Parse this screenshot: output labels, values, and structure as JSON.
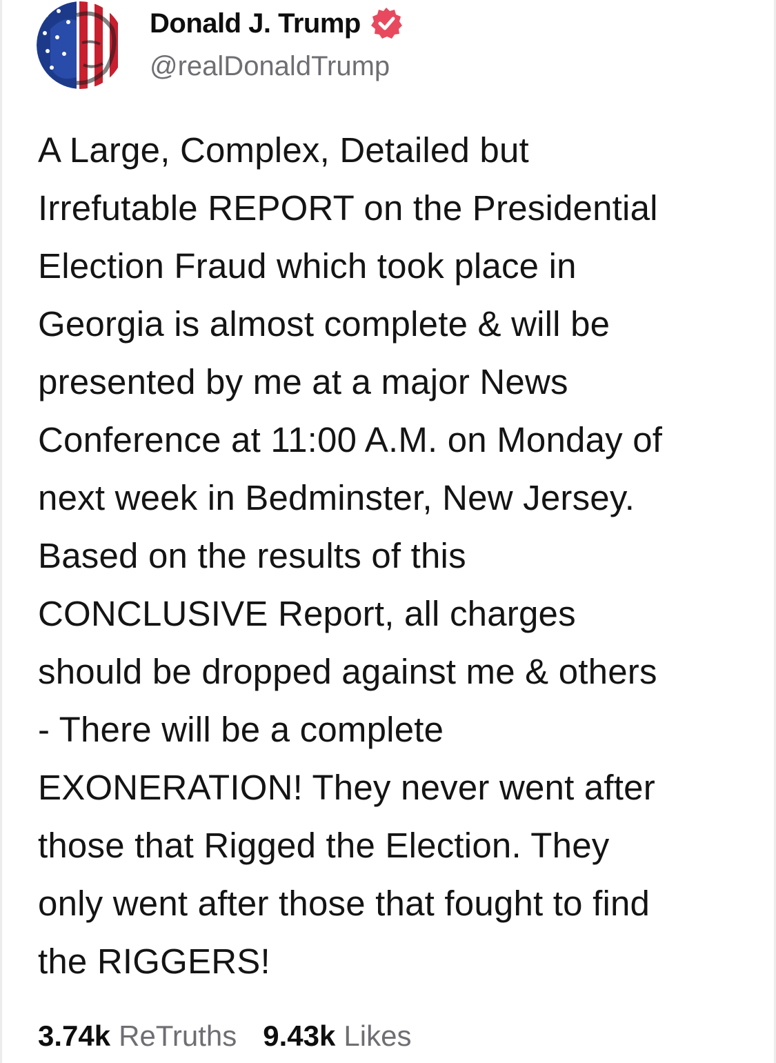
{
  "author": {
    "display_name": "Donald J. Trump",
    "handle": "@realDonaldTrump",
    "verified_icon": "verified-badge-icon",
    "avatar_icon": "flag-portrait-avatar"
  },
  "post": {
    "lines": [
      "A Large, Complex, Detailed but",
      "Irrefutable REPORT on the Presidential",
      "Election Fraud which took place in",
      "Georgia is almost complete & will be",
      "presented by me at a major News",
      "Conference at 11:00 A.M. on Monday of",
      "next week in Bedminster, New Jersey.",
      "Based on the results of this",
      "CONCLUSIVE Report, all charges",
      "should be dropped against me & others",
      "- There will be a complete",
      "EXONERATION! They never went after",
      "those that Rigged the Election. They",
      "only went after those that fought to find",
      "the RIGGERS!"
    ]
  },
  "stats": {
    "retruths_count": "3.74k",
    "retruths_label": "ReTruths",
    "likes_count": "9.43k",
    "likes_label": "Likes"
  },
  "colors": {
    "verified": "#e8495e",
    "text_primary": "#141414",
    "text_secondary": "#6e6e73",
    "flag_red": "#c8202f",
    "flag_blue": "#1d3a8a"
  }
}
